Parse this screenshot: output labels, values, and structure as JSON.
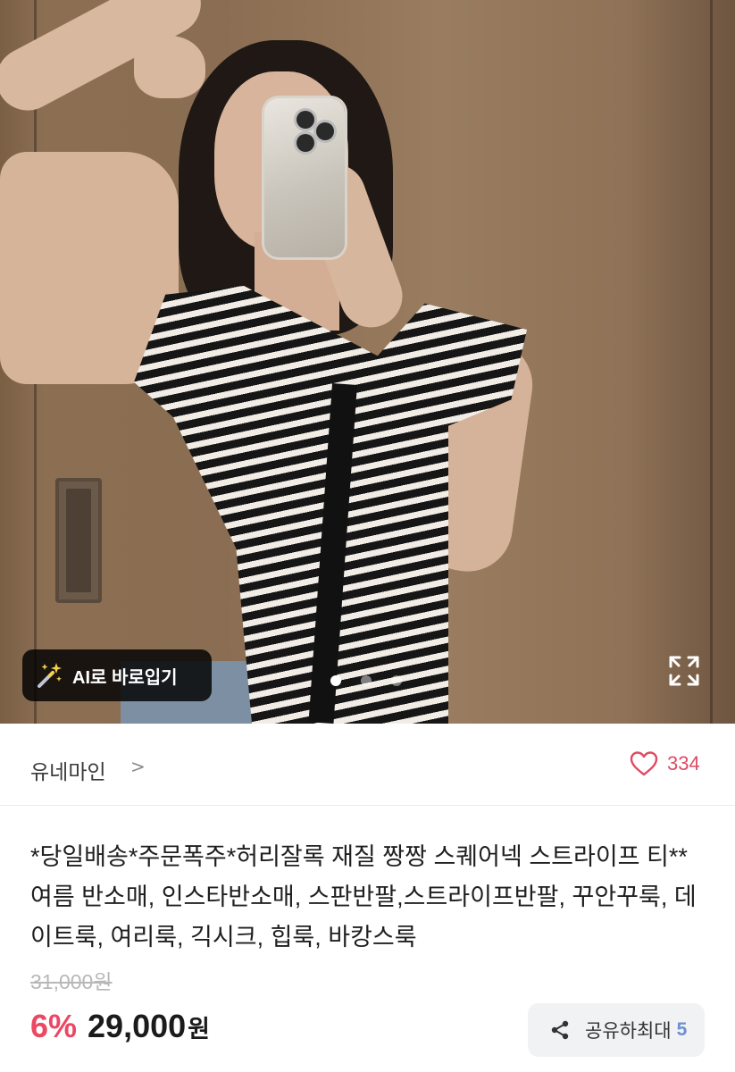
{
  "product_image": {
    "ai_try_on_label": "AI로 바로입기",
    "carousel": {
      "total": 3,
      "active": 1
    },
    "icons": {
      "ai_wand": "magic-wand-icon",
      "expand": "expand-icon"
    }
  },
  "seller": {
    "name": "유네마인",
    "chevron": ">",
    "likes": "334",
    "accent_color": "#e04a62"
  },
  "product": {
    "title": "*당일배송*주문폭주*허리잘록 재질 짱짱 스퀘어넥 스트라이프 티** 여름 반소매, 인스타반소매, 스판반팔,스트라이프반팔, 꾸안꾸룩, 데이트룩, 여리룩, 긱시크, 힙룩, 바캉스룩",
    "original_price": "31,000원",
    "discount": "6%",
    "price": "29,000",
    "currency": "원",
    "discount_color": "#ec4763"
  },
  "share": {
    "label": "공유하",
    "max_label": "최대",
    "count": "5",
    "icon": "share-icon"
  }
}
